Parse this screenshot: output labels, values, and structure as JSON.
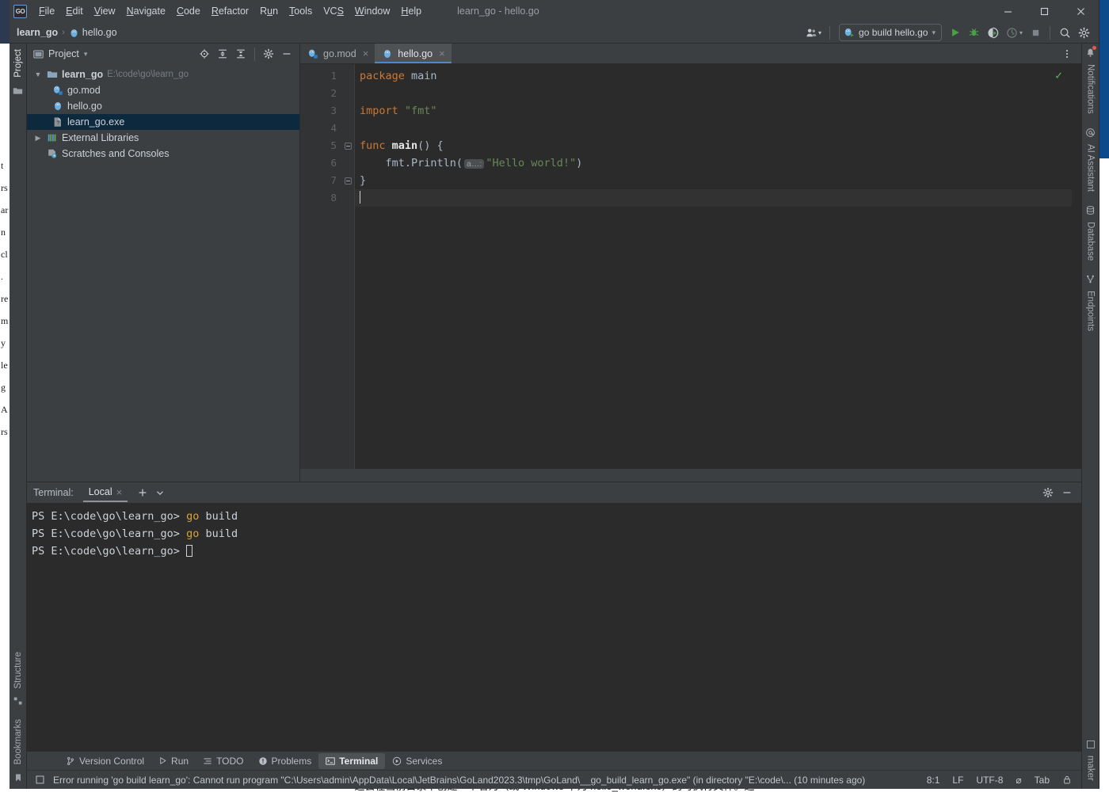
{
  "window": {
    "title": "learn_go - hello.go",
    "logo_text": "GO",
    "controls": {
      "minimize": "minimize-icon",
      "maximize": "maximize-icon",
      "close": "close-icon"
    }
  },
  "menubar": [
    {
      "label": "File",
      "mnemonic": "F"
    },
    {
      "label": "Edit",
      "mnemonic": "E"
    },
    {
      "label": "View",
      "mnemonic": "V"
    },
    {
      "label": "Navigate",
      "mnemonic": "N"
    },
    {
      "label": "Code",
      "mnemonic": "C"
    },
    {
      "label": "Refactor",
      "mnemonic": "R"
    },
    {
      "label": "Run",
      "mnemonic": "u"
    },
    {
      "label": "Tools",
      "mnemonic": "T"
    },
    {
      "label": "VCS",
      "mnemonic": "S"
    },
    {
      "label": "Window",
      "mnemonic": "W"
    },
    {
      "label": "Help",
      "mnemonic": "H"
    }
  ],
  "navbar": {
    "crumbs": [
      {
        "label": "learn_go",
        "icon": "project-icon",
        "bold": true
      },
      {
        "label": "hello.go",
        "icon": "go-file-icon",
        "bold": false
      }
    ],
    "separator": "›",
    "run_config": {
      "label": "go build hello.go",
      "icon": "go-run-config-icon",
      "chevron": "▾"
    },
    "buttons": [
      {
        "name": "account-button",
        "icon": "user-icon"
      },
      {
        "name": "run-button",
        "icon": "play-icon"
      },
      {
        "name": "debug-button",
        "icon": "bug-icon"
      },
      {
        "name": "run-coverage-button",
        "icon": "coverage-icon"
      },
      {
        "name": "profiler-button",
        "icon": "profiler-icon"
      },
      {
        "name": "stop-button",
        "icon": "stop-icon"
      },
      {
        "name": "search-everywhere-button",
        "icon": "search-icon"
      },
      {
        "name": "settings-button",
        "icon": "gear-icon"
      }
    ]
  },
  "left_strip": {
    "top": [
      {
        "label": "Project",
        "icon": "project-window-icon",
        "active": true
      }
    ],
    "bottom": [
      {
        "label": "Structure",
        "icon": "structure-icon",
        "active": false
      },
      {
        "label": "Bookmarks",
        "icon": "bookmark-icon",
        "active": false
      }
    ]
  },
  "right_strip": {
    "top": [
      {
        "label": "Notifications",
        "icon": "bell-icon",
        "badge": true
      },
      {
        "label": "AI Assistant",
        "icon": "at-icon",
        "badge": false
      },
      {
        "label": "Database",
        "icon": "database-icon",
        "badge": false
      },
      {
        "label": "Endpoints",
        "icon": "endpoints-icon",
        "badge": false
      }
    ],
    "bottom": [
      {
        "label": "maker",
        "icon": "maker-icon",
        "badge": false
      }
    ]
  },
  "project_panel": {
    "title": "Project",
    "title_icon": "project-window-icon",
    "chevron": "▾",
    "toolbar": [
      {
        "name": "select-opened-file-button",
        "icon": "locate-icon"
      },
      {
        "name": "expand-all-button",
        "icon": "expand-all-icon"
      },
      {
        "name": "collapse-all-button",
        "icon": "collapse-all-icon"
      },
      {
        "name": "project-settings-button",
        "icon": "gear-icon"
      },
      {
        "name": "hide-panel-button",
        "icon": "minimize-icon"
      }
    ],
    "tree": [
      {
        "label": "learn_go",
        "path": "E:\\code\\go\\learn_go",
        "icon": "folder-icon",
        "indent": 0,
        "arrow": "expanded",
        "bold": true,
        "selected": false
      },
      {
        "label": "go.mod",
        "path": "",
        "icon": "go-mod-icon",
        "indent": 1,
        "arrow": "none",
        "bold": false,
        "selected": false
      },
      {
        "label": "hello.go",
        "path": "",
        "icon": "go-file-icon",
        "indent": 1,
        "arrow": "none",
        "bold": false,
        "selected": false
      },
      {
        "label": "learn_go.exe",
        "path": "",
        "icon": "exe-file-icon",
        "indent": 1,
        "arrow": "none",
        "bold": false,
        "selected": true
      },
      {
        "label": "External Libraries",
        "path": "",
        "icon": "libraries-icon",
        "indent": 0,
        "arrow": "collapsed",
        "bold": false,
        "selected": false
      },
      {
        "label": "Scratches and Consoles",
        "path": "",
        "icon": "scratches-icon",
        "indent": 0,
        "arrow": "none",
        "bold": false,
        "selected": false
      }
    ]
  },
  "editor": {
    "tabs": [
      {
        "label": "go.mod",
        "icon": "go-mod-icon",
        "active": false,
        "close": "×"
      },
      {
        "label": "hello.go",
        "icon": "go-file-icon",
        "active": true,
        "close": "×"
      }
    ],
    "more_button": "more-options-icon",
    "inspection_status": "✓",
    "line_numbers": [
      "1",
      "2",
      "3",
      "4",
      "5",
      "6",
      "7",
      "8"
    ],
    "current_line": 8,
    "run_marker_line": 5,
    "code_lines": [
      {
        "n": 1,
        "tokens": [
          {
            "t": "package ",
            "c": "kw"
          },
          {
            "t": "main",
            "c": "plain"
          }
        ]
      },
      {
        "n": 2,
        "tokens": []
      },
      {
        "n": 3,
        "tokens": [
          {
            "t": "import ",
            "c": "kw"
          },
          {
            "t": "\"fmt\"",
            "c": "str"
          }
        ]
      },
      {
        "n": 4,
        "tokens": []
      },
      {
        "n": 5,
        "tokens": [
          {
            "t": "func ",
            "c": "kw"
          },
          {
            "t": "main",
            "c": "fname"
          },
          {
            "t": "() {",
            "c": "plain"
          }
        ]
      },
      {
        "n": 6,
        "tokens": [
          {
            "t": "    fmt.Println(",
            "c": "plain"
          },
          {
            "t": "a…:",
            "c": "hint"
          },
          {
            "t": "\"Hello world!\"",
            "c": "str"
          },
          {
            "t": ")",
            "c": "plain"
          }
        ]
      },
      {
        "n": 7,
        "tokens": [
          {
            "t": "}",
            "c": "plain"
          }
        ]
      },
      {
        "n": 8,
        "tokens": []
      }
    ]
  },
  "terminal": {
    "label": "Terminal:",
    "tab": {
      "label": "Local",
      "close": "×"
    },
    "add_button": "+",
    "chevron_button": "⌄",
    "settings_button": "gear-icon",
    "hide_button": "minimize-icon",
    "lines": [
      {
        "prompt": "PS E:\\code\\go\\learn_go> ",
        "cmd": "go",
        "rest": " build",
        "caret": false
      },
      {
        "prompt": "PS E:\\code\\go\\learn_go> ",
        "cmd": "go",
        "rest": " build",
        "caret": false
      },
      {
        "prompt": "PS E:\\code\\go\\learn_go> ",
        "cmd": "",
        "rest": "",
        "caret": true
      }
    ]
  },
  "bottom_tabs": [
    {
      "label": "Version Control",
      "icon": "branch-icon",
      "active": false
    },
    {
      "label": "Run",
      "icon": "play-icon",
      "active": false
    },
    {
      "label": "TODO",
      "icon": "todo-icon",
      "active": false
    },
    {
      "label": "Problems",
      "icon": "problems-icon",
      "active": false
    },
    {
      "label": "Terminal",
      "icon": "terminal-icon",
      "active": true
    },
    {
      "label": "Services",
      "icon": "services-icon",
      "active": false
    }
  ],
  "statusbar": {
    "icon": "event-log-icon",
    "message": "Error running 'go build learn_go': Cannot run program \"C:\\Users\\admin\\AppData\\Local\\JetBrains\\GoLand2023.3\\tmp\\GoLand\\__go_build_learn_go.exe\" (in directory \"E:\\code\\... (10 minutes ago)",
    "right": [
      {
        "name": "caret-position",
        "label": "8:1"
      },
      {
        "name": "line-separator",
        "label": "LF"
      },
      {
        "name": "file-encoding",
        "label": "UTF-8"
      },
      {
        "name": "inspection-toggle",
        "label": "⌀"
      },
      {
        "name": "indent-setting",
        "label": "Tab"
      },
      {
        "name": "lock-toggle",
        "label": "lock-icon"
      }
    ]
  },
  "background": {
    "bottom_text": "这会在当前目录下创建一个名为（或 Windows 下为 hello_world.exe）的可执行文件。运",
    "left_fragments": [
      "t",
      "rs",
      "ar",
      "n",
      "cl",
      ".",
      "re",
      "m",
      "y",
      "le",
      "g",
      "A",
      "rs"
    ],
    "right_fragments": []
  }
}
